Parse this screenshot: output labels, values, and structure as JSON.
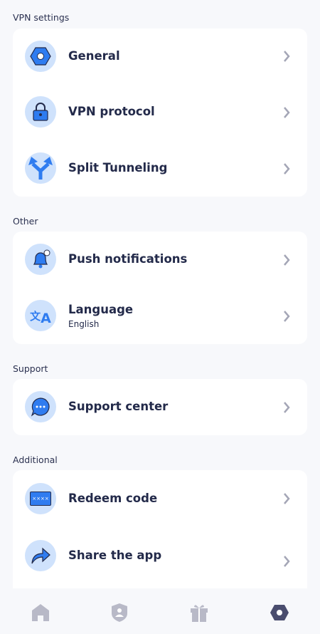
{
  "sections": {
    "vpn": "VPN settings",
    "other": "Other",
    "support": "Support",
    "additional": "Additional"
  },
  "items": {
    "general": "General",
    "protocol": "VPN protocol",
    "split": "Split Tunneling",
    "push": "Push notifications",
    "language": "Language",
    "language_value": "English",
    "support": "Support center",
    "redeem": "Redeem code",
    "redeem_icon_text": "××××",
    "share": "Share the app"
  },
  "nav": [
    "home-icon",
    "shield-user-icon",
    "gift-icon",
    "settings-hex-icon"
  ],
  "colors": {
    "accent": "#2f7cf0",
    "iconBg": "#cfe2fc",
    "text": "#232a4a",
    "navActive": "#4a4d6e",
    "navInactive": "#b8b9c7"
  }
}
